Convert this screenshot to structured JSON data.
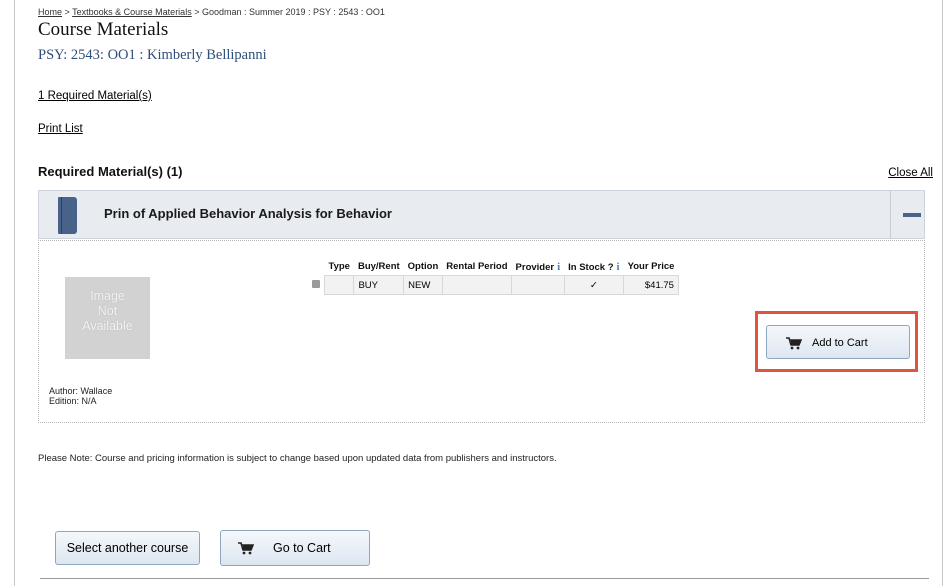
{
  "breadcrumb": {
    "home": "Home",
    "sep1": ">",
    "textbooks": "Textbooks & Course Materials",
    "sep2": ">",
    "rest": "Goodman : Summer 2019 : PSY : 2543 : OO1"
  },
  "page_title": "Course Materials",
  "course_line": "PSY: 2543: OO1 : Kimberly Bellipanni",
  "links": {
    "required_count": "1 Required Material(s)",
    "print_list": "Print List"
  },
  "section": {
    "title": "Required Material(s) (1)",
    "close_all": "Close All"
  },
  "material": {
    "title": "Prin of Applied Behavior Analysis for Behavior",
    "image_placeholder": [
      "Image",
      "Not",
      "Available"
    ],
    "author": "Author: Wallace",
    "edition": "Edition: N/A",
    "table": {
      "headers": {
        "type": "Type",
        "buy_rent": "Buy/Rent",
        "option": "Option",
        "rental_period": "Rental Period",
        "provider": "Provider",
        "in_stock": "In Stock ?",
        "your_price": "Your Price"
      },
      "info_glyph": "i",
      "row": {
        "checked": true,
        "type": "",
        "buy_rent": "BUY",
        "option": "NEW",
        "rental_period": "",
        "provider": "",
        "in_stock": "✓",
        "price": "$41.75"
      }
    },
    "add_to_cart": "Add to Cart"
  },
  "note": "Please Note: Course and pricing information is subject to change based upon updated data from publishers and instructors.",
  "footer_buttons": {
    "select_course": "Select another course",
    "go_to_cart": "Go to Cart"
  },
  "colors": {
    "course_line": "#2e4f7a",
    "panel_header_bg": "#e8ecf1",
    "book_icon": "#49628a",
    "highlight_border": "#e0533d",
    "info_icon": "#5a7fb8"
  },
  "icons": [
    "book-icon",
    "collapse-icon",
    "checkbox-icon",
    "info-icon",
    "cart-icon"
  ]
}
